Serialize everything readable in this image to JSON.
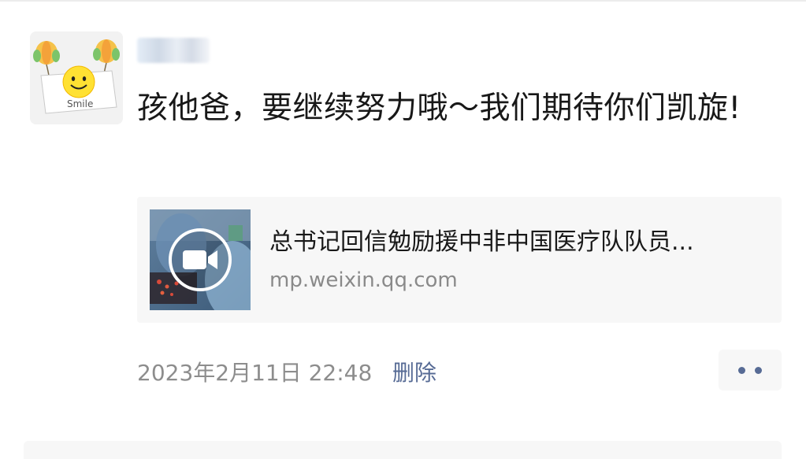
{
  "post": {
    "author_name": "",
    "text": "孩他爸，要继续努力哦～我们期待你们凯旋!",
    "avatar_icon": "smile-balloons-avatar",
    "avatar_text": "Smile"
  },
  "link": {
    "title": "总书记回信勉励援中非中国医疗队队员...",
    "domain": "mp.weixin.qq.com",
    "thumbnail_icon": "video-camera-icon"
  },
  "meta": {
    "timestamp": "2023年2月11日 22:48",
    "delete_label": "删除",
    "more_icon": "more-dots-icon",
    "link_color": "#576b95"
  }
}
